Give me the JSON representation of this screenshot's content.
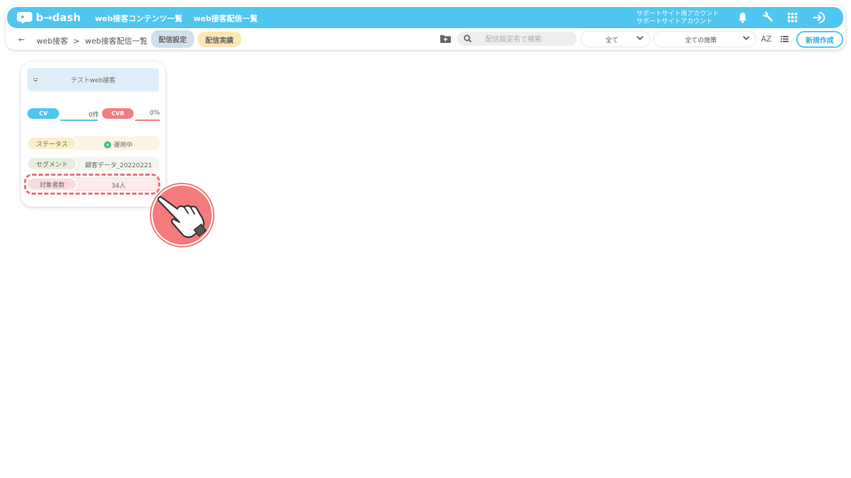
{
  "app": {
    "logo_text": "b→dash"
  },
  "topnav": {
    "contents_list": "web接客コンテンツ一覧",
    "delivery_list": "web接客配信一覧"
  },
  "support": {
    "line1": "サポートサイト用アカウント",
    "line2": "サポートサイトアカウント"
  },
  "top_icons": [
    "bell-icon",
    "wrench-icon",
    "grid-icon",
    "logout-icon"
  ],
  "breadcrumb": {
    "back": "←",
    "root": "web接客",
    "separator": ">",
    "current": "web接客配信一覧"
  },
  "tabs": [
    {
      "label": "配信設定",
      "active": true,
      "color": "#cfe0ec"
    },
    {
      "label": "配信実績",
      "active": false,
      "color": "#fbe7b4"
    }
  ],
  "toolbar": {
    "search_placeholder": "配信設定名で検索",
    "filter_all": "全て",
    "filter_measures": "全ての施策",
    "sort_label": "AZ",
    "new_button": "新規作成"
  },
  "card": {
    "title": "テストweb接客",
    "cv_label": "CV",
    "cv_value": "0件",
    "cvr_label": "CVR",
    "cvr_value": "0%",
    "rows": [
      {
        "label": "ステータス",
        "value": "運用中",
        "label_bg": "#fbeec8",
        "row_bg": "#fcf5e3"
      },
      {
        "label": "セグメント",
        "value": "顧客データ_20220221",
        "label_bg": "#e8eddc",
        "row_bg": "#f3f5ee"
      },
      {
        "label": "対象者数",
        "value": "34人",
        "label_bg": "#fbdcdc",
        "row_bg": "#fdeaea"
      }
    ]
  },
  "colors": {
    "brand": "#4fc6f0",
    "cv": "#4fc6f0",
    "cvr": "#f07f82",
    "highlight": "#ef6f7f",
    "status_running": "#3bbf8a"
  }
}
